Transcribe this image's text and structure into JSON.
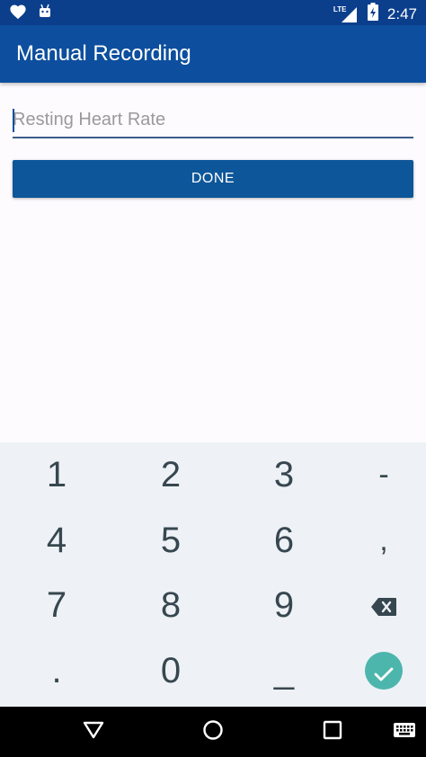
{
  "status_bar": {
    "time": "2:47",
    "network": "LTE",
    "icons": [
      "heart-icon",
      "android-icon",
      "signal-icon",
      "battery-charging-icon"
    ]
  },
  "app_bar": {
    "title": "Manual Recording"
  },
  "form": {
    "input_value": "",
    "input_placeholder": "Resting Heart Rate",
    "done_label": "DONE"
  },
  "keyboard": {
    "keys": [
      [
        "1",
        "2",
        "3",
        "-"
      ],
      [
        "4",
        "5",
        "6",
        ","
      ],
      [
        "7",
        "8",
        "9",
        "backspace"
      ],
      [
        ".",
        "0",
        "_",
        "enter"
      ]
    ]
  },
  "colors": {
    "status_bar": "#0b3f8c",
    "app_bar": "#0d4f9e",
    "button": "#0d5699",
    "keyboard_bg": "#eef2f7",
    "enter_key": "#4db6ac"
  }
}
